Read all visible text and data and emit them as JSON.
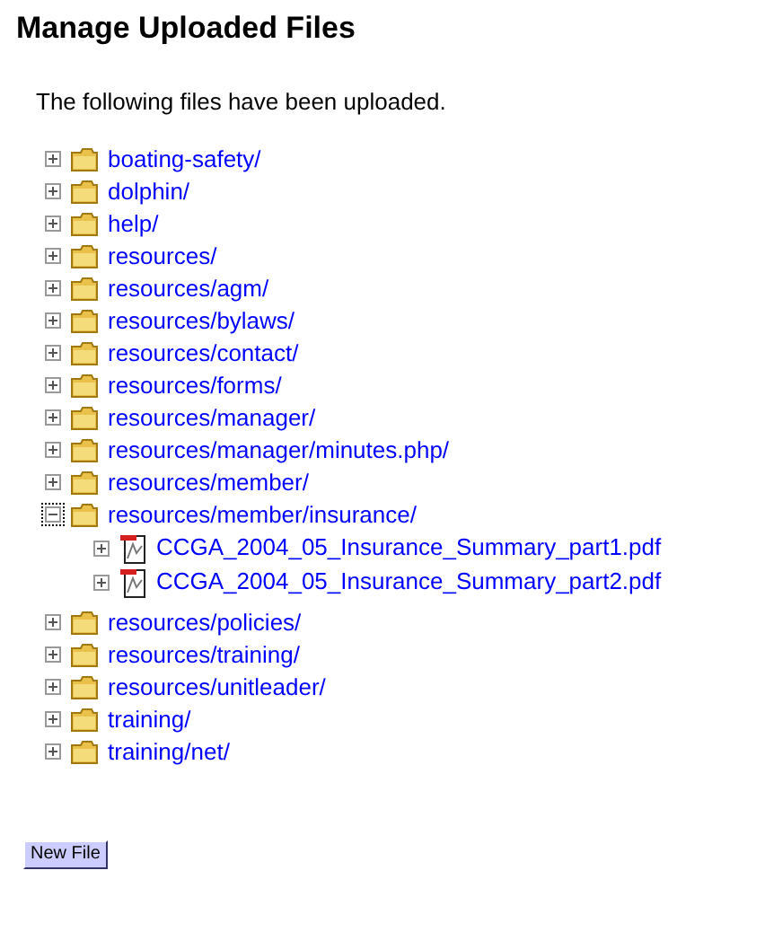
{
  "title": "Manage Uploaded Files",
  "intro": "The following files have been uploaded.",
  "tree": [
    {
      "kind": "folder",
      "label": "boating-safety/",
      "expanded": false
    },
    {
      "kind": "folder",
      "label": "dolphin/",
      "expanded": false
    },
    {
      "kind": "folder",
      "label": "help/",
      "expanded": false
    },
    {
      "kind": "folder",
      "label": "resources/",
      "expanded": false
    },
    {
      "kind": "folder",
      "label": "resources/agm/",
      "expanded": false
    },
    {
      "kind": "folder",
      "label": "resources/bylaws/",
      "expanded": false
    },
    {
      "kind": "folder",
      "label": "resources/contact/",
      "expanded": false
    },
    {
      "kind": "folder",
      "label": "resources/forms/",
      "expanded": false
    },
    {
      "kind": "folder",
      "label": "resources/manager/",
      "expanded": false
    },
    {
      "kind": "folder",
      "label": "resources/manager/minutes.php/",
      "expanded": false
    },
    {
      "kind": "folder",
      "label": "resources/member/",
      "expanded": false
    },
    {
      "kind": "folder",
      "label": "resources/member/insurance/",
      "expanded": true,
      "children": [
        {
          "kind": "pdf",
          "label": "CCGA_2004_05_Insurance_Summary_part1.pdf",
          "expanded": false
        },
        {
          "kind": "pdf",
          "label": "CCGA_2004_05_Insurance_Summary_part2.pdf",
          "expanded": false
        }
      ]
    },
    {
      "kind": "folder",
      "label": "resources/policies/",
      "expanded": false
    },
    {
      "kind": "folder",
      "label": "resources/training/",
      "expanded": false
    },
    {
      "kind": "folder",
      "label": "resources/unitleader/",
      "expanded": false
    },
    {
      "kind": "folder",
      "label": "training/",
      "expanded": false
    },
    {
      "kind": "folder",
      "label": "training/net/",
      "expanded": false
    }
  ],
  "button": "New File"
}
